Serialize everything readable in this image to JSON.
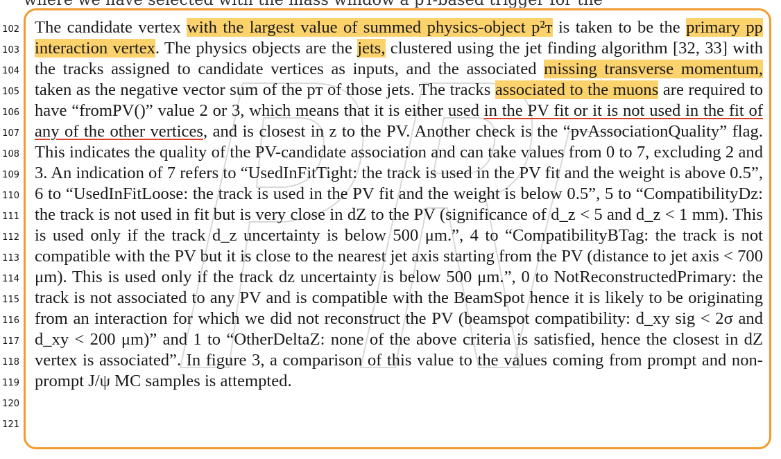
{
  "top_partial_line": "where we have selected with the mass window a pT-based trigger for the",
  "line_numbers": [
    "102",
    "103",
    "104",
    "105",
    "106",
    "107",
    "108",
    "109",
    "110",
    "111",
    "112",
    "113",
    "114",
    "115",
    "116",
    "117",
    "118",
    "119",
    "120",
    "121"
  ],
  "paragraph": {
    "s01": "The candidate vertex ",
    "h01": "with the largest value of summed physics-object p²ᴛ",
    "s02": " is taken to be the ",
    "h02": "primary pp interaction vertex",
    "s03": ". The physics objects are the ",
    "h03": "jets,",
    "s04": " clustered using the jet finding algorithm [32, 33] with the tracks assigned to candidate vertices as inputs, and the associated ",
    "h04": "missing transverse momentum,",
    "s05": " taken as the negative vector sum of the pᴛ of those jets. The tracks ",
    "h05": "associated to the muons",
    "s06": " are required to have “fromPV()” value 2 or 3, which means that it is either used ",
    "u01": "in the PV fit or it is not used in the fit of any of the other vertices",
    "s07": ", and is closest in z to the PV. Another check is the “pvAssociationQuality” flag. This indicates the quality of the PV-candidate association and can take values from 0 to 7, excluding 2 and 3. An indication of 7 refers to “UsedInFitTight: the track is used in the PV fit and the weight is above 0.5”, 6 to “UsedInFitLoose: the track is used in the PV fit and the weight is below 0.5”, 5 to “CompatibilityDz: the track is not used in fit but is very close in dZ to the PV (significance of d_z < 5 and d_z < 1 mm). This is used only if the track d_z uncertainty is below 500 μm.”, 4 to “CompatibilityBTag: the track is not compatible with the PV but it is close to the nearest jet axis starting from the PV (distance to jet axis < 700 μm). This is used only if the track dz uncertainty is below 500 μm.”, 0 to NotReconstructedPrimary: the track is not associated to any PV and is compatible with the BeamSpot hence it is likely to be originating from an interaction for which we did not reconstruct the PV (beamspot compatibility: d_xy sig < 2σ and d_xy < 200 μm)” and 1 to “OtherDeltaZ: none of the above criteria is satisfied, hence the closest in dZ vertex is associated”. In figure 3, a comparison of this value to the values coming from prompt and non-prompt J/ψ MC samples is attempted."
  },
  "colors": {
    "frame": "#f29b2e",
    "highlight": "#fcd26c",
    "underline": "#e0402a"
  }
}
